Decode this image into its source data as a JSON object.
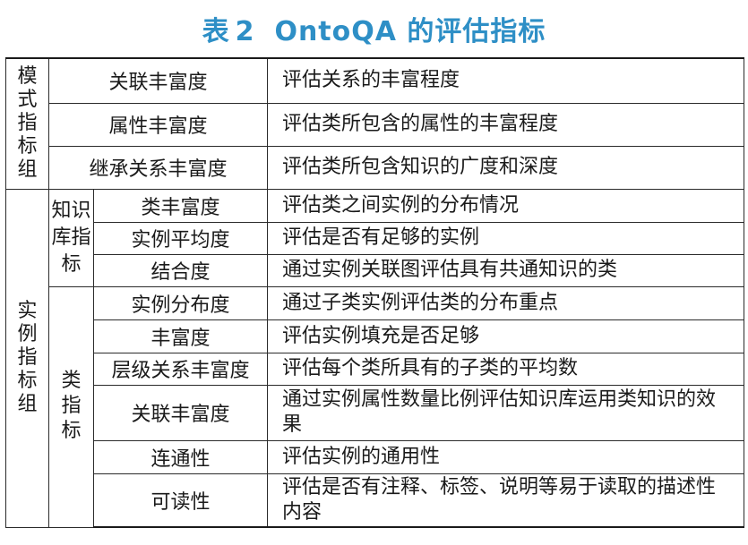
{
  "title": {
    "label": "表",
    "number": "2",
    "text": "OntoQA 的评估指标"
  },
  "colors": {
    "title": "#2e8fc6",
    "border": "#1a1a1a",
    "text": "#1a1a1a"
  },
  "schema_group": {
    "label": "模式指标组",
    "rows": [
      {
        "name": "关联丰富度",
        "desc": "评估关系的丰富程度"
      },
      {
        "name": "属性丰富度",
        "desc": "评估类所包含的属性的丰富程度"
      },
      {
        "name": "继承关系丰富度",
        "desc": "评估类所包含知识的广度和深度"
      }
    ]
  },
  "instance_group": {
    "label": "实例指标组",
    "kb_subgroup": {
      "label": "知识库指标",
      "rows": [
        {
          "name": "类丰富度",
          "desc": "评估类之间实例的分布情况"
        },
        {
          "name": "实例平均度",
          "desc": "评估是否有足够的实例"
        },
        {
          "name": "结合度",
          "desc": "通过实例关联图评估具有共通知识的类"
        }
      ]
    },
    "class_subgroup": {
      "label": "类指标",
      "rows": [
        {
          "name": "实例分布度",
          "desc": "通过子类实例评估类的分布重点"
        },
        {
          "name": "丰富度",
          "desc": "评估实例填充是否足够"
        },
        {
          "name": "层级关系丰富度",
          "desc": "评估每个类所具有的子类的平均数"
        },
        {
          "name": "关联丰富度",
          "desc": "通过实例属性数量比例评估知识库运用类知识的效果"
        },
        {
          "name": "连通性",
          "desc": "评估实例的通用性"
        },
        {
          "name": "可读性",
          "desc": "评估是否有注释、标签、说明等易于读取的描述性内容"
        }
      ]
    }
  }
}
